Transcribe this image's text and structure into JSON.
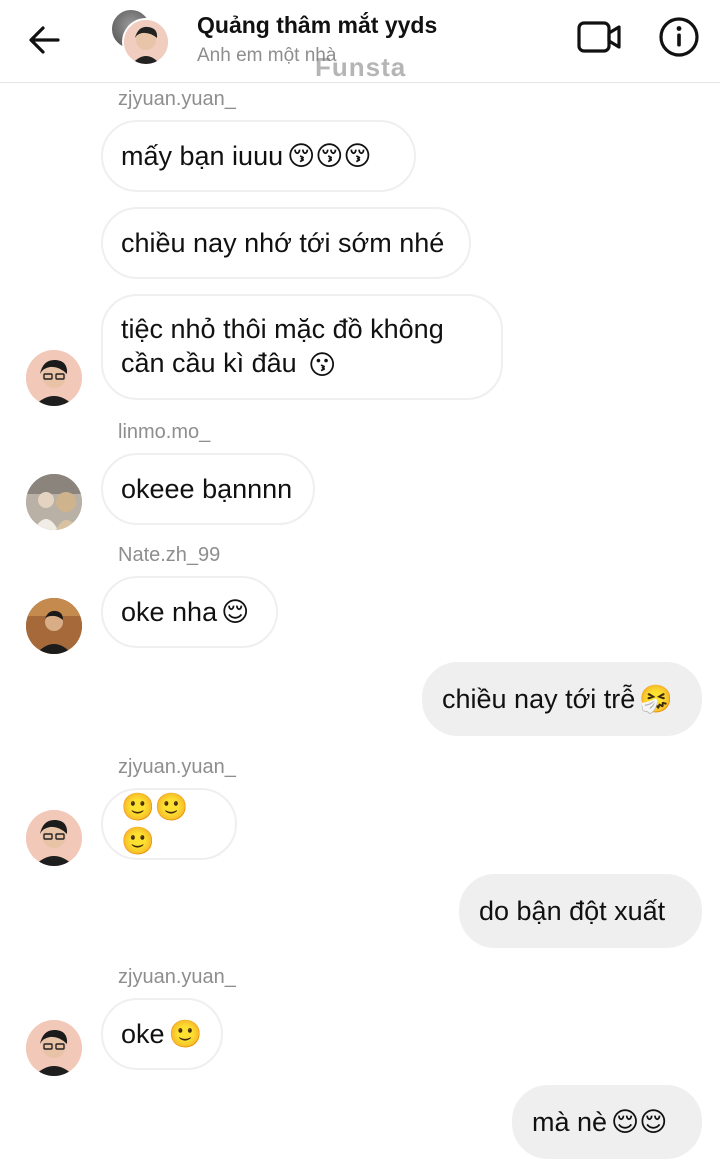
{
  "header": {
    "title": "Quảng thâm mắt yyds",
    "subtitle": "Anh em một nhà",
    "watermark": "Funsta"
  },
  "messages": [
    {
      "sender": "zjyuan.yuan_",
      "text": "mấy bạn iuuu",
      "emoji": "😚😚😚"
    },
    {
      "text": "chiều nay nhớ tới sớm nhé"
    },
    {
      "text_line1": "tiệc nhỏ thôi mặc đồ không",
      "text_line2": "cần cầu kì đâu",
      "emoji": "😗"
    },
    {
      "sender": "linmo.mo_",
      "text": "okeee bạnnnn"
    },
    {
      "sender": "Nate.zh_99",
      "text": "oke nha",
      "emoji": "😌"
    },
    {
      "text": "chiều nay tới trễ",
      "emoji": "🤧"
    },
    {
      "sender": "zjyuan.yuan_",
      "emoji": "🙂🙂🙂"
    },
    {
      "text": "do bận đột xuất"
    },
    {
      "sender": "zjyuan.yuan_",
      "text": "oke",
      "emoji": "🙂"
    },
    {
      "text": "mà nè",
      "emoji": "😌😌"
    }
  ],
  "icons": {
    "back": "back-arrow-icon",
    "video": "video-call-icon",
    "info": "info-icon"
  },
  "colors": {
    "outgoing_bubble": "#efefef",
    "incoming_border": "#efefef",
    "sender_text": "#8e8e8e"
  }
}
